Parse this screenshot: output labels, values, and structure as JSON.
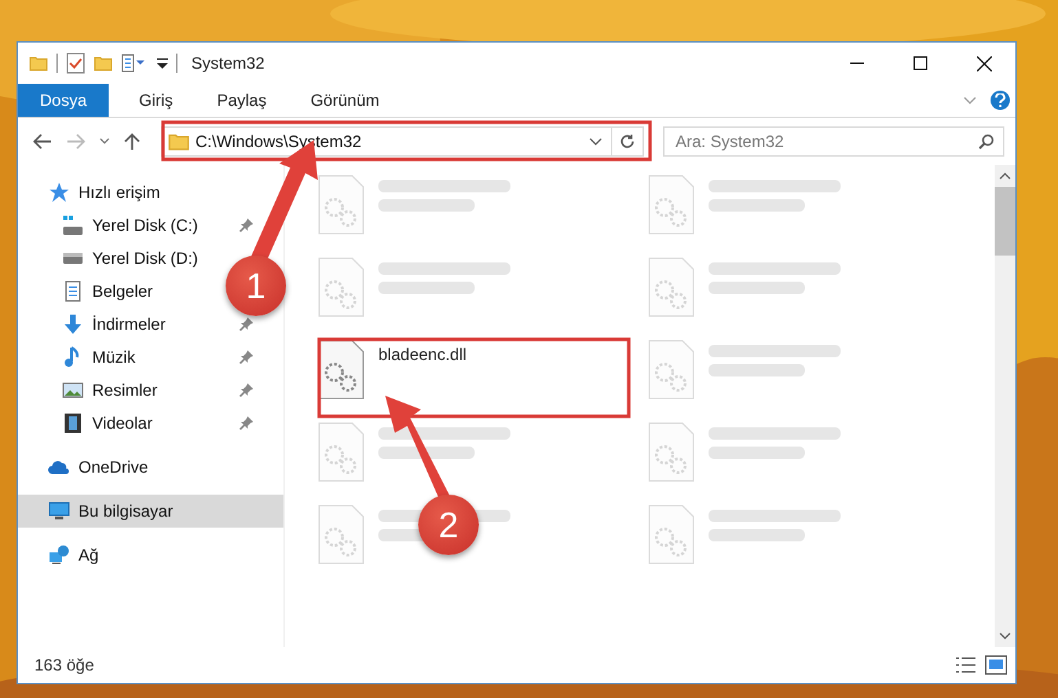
{
  "window": {
    "title": "System32"
  },
  "ribbon_tabs": [
    {
      "label": "Dosya",
      "selected": true
    },
    {
      "label": "Giriş",
      "selected": false
    },
    {
      "label": "Paylaş",
      "selected": false
    },
    {
      "label": "Görünüm",
      "selected": false
    }
  ],
  "address": {
    "value": "C:\\Windows\\System32"
  },
  "search": {
    "placeholder": "Ara: System32"
  },
  "sidebar": {
    "items": [
      {
        "label": "Hızlı erişim",
        "kind": "star",
        "selected": false,
        "children": [
          {
            "label": "Yerel Disk (C:)",
            "kind": "drive-windows",
            "pinned": true,
            "selected": false
          },
          {
            "label": "Yerel Disk (D:)",
            "kind": "drive",
            "pinned": false,
            "selected": false
          },
          {
            "label": "Belgeler",
            "kind": "documents",
            "pinned": false,
            "selected": false
          },
          {
            "label": "İndirmeler",
            "kind": "download",
            "pinned": true,
            "selected": false
          },
          {
            "label": "Müzik",
            "kind": "music",
            "pinned": true,
            "selected": false
          },
          {
            "label": "Resimler",
            "kind": "pictures",
            "pinned": true,
            "selected": false
          },
          {
            "label": "Videolar",
            "kind": "videos",
            "pinned": true,
            "selected": false
          }
        ]
      },
      {
        "label": "OneDrive",
        "kind": "cloud",
        "selected": false
      },
      {
        "label": "Bu bilgisayar",
        "kind": "computer",
        "selected": true
      },
      {
        "label": "Ağ",
        "kind": "network",
        "selected": false
      }
    ]
  },
  "files": [
    {
      "kind": "blurred"
    },
    {
      "kind": "blurred"
    },
    {
      "kind": "blurred"
    },
    {
      "kind": "blurred"
    },
    {
      "kind": "file",
      "name": "bladeenc.dll"
    },
    {
      "kind": "blurred"
    },
    {
      "kind": "blurred"
    },
    {
      "kind": "blurred"
    },
    {
      "kind": "blurred"
    },
    {
      "kind": "blurred"
    }
  ],
  "status_bar": {
    "item_count": "163 öğe"
  },
  "steps": [
    {
      "number": "1"
    },
    {
      "number": "2"
    }
  ]
}
